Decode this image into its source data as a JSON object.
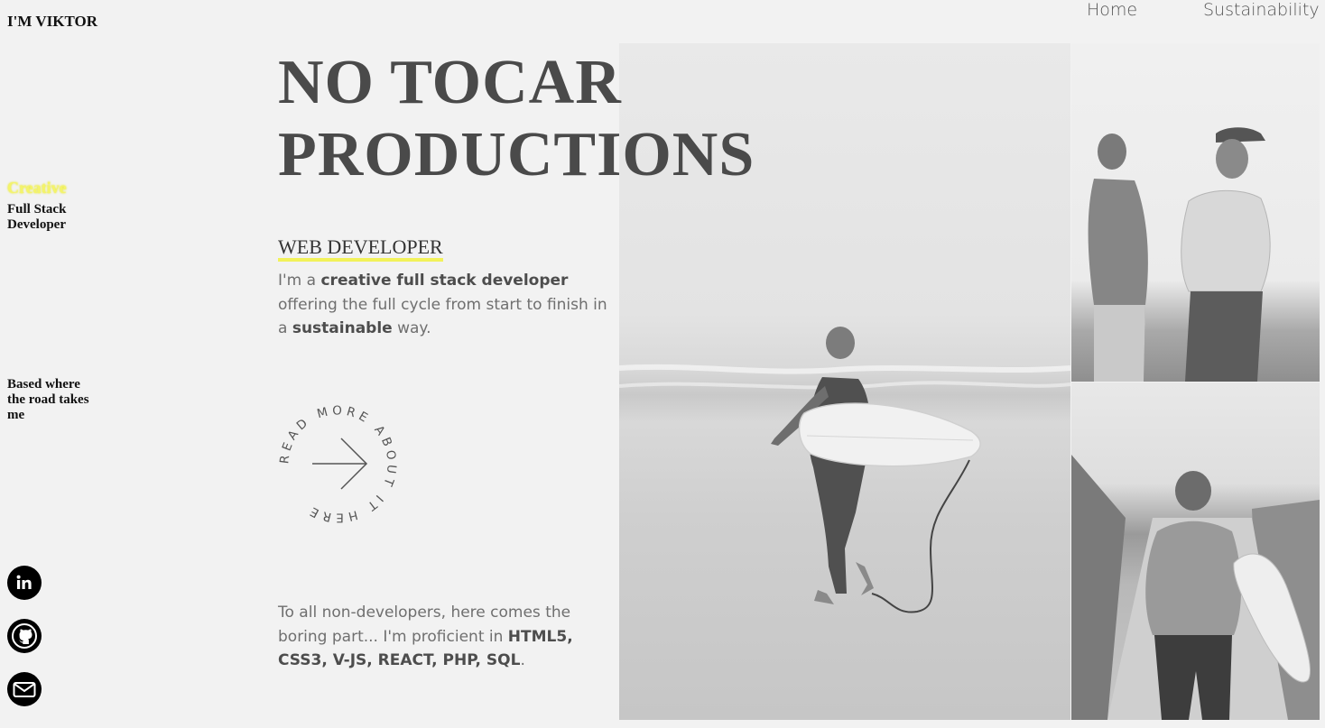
{
  "brand": "I'M VIKTOR",
  "sidebar": {
    "creative": "Creative",
    "role": "Full Stack Developer",
    "based": "Based where the road takes me"
  },
  "nav": {
    "home": "Home",
    "sustainability": "Sustainability"
  },
  "hero": {
    "title_line1": "NO TOCAR",
    "title_line2": "PRODUCTIONS",
    "subtitle": "WEB DEVELOPER",
    "intro": {
      "p1": "I'm a ",
      "b1": "creative full stack developer",
      "p2": " offering the full cycle from start to finish in a ",
      "b2": "sustainable",
      "p3": " way."
    },
    "read_more": "READ MORE ABOUT IT HERE",
    "boring": {
      "p1": "To all non-developers, here comes the boring part... I'm proficient in ",
      "b1": "HTML5, CSS3, V-JS, REACT, PHP, SQL",
      "p2": "."
    }
  },
  "social_icons": [
    "linkedin-icon",
    "github-icon",
    "email-icon"
  ],
  "colors": {
    "accent_yellow": "#f2f25a",
    "background": "#f2f2f2",
    "title_gray": "#4a4a4a"
  }
}
